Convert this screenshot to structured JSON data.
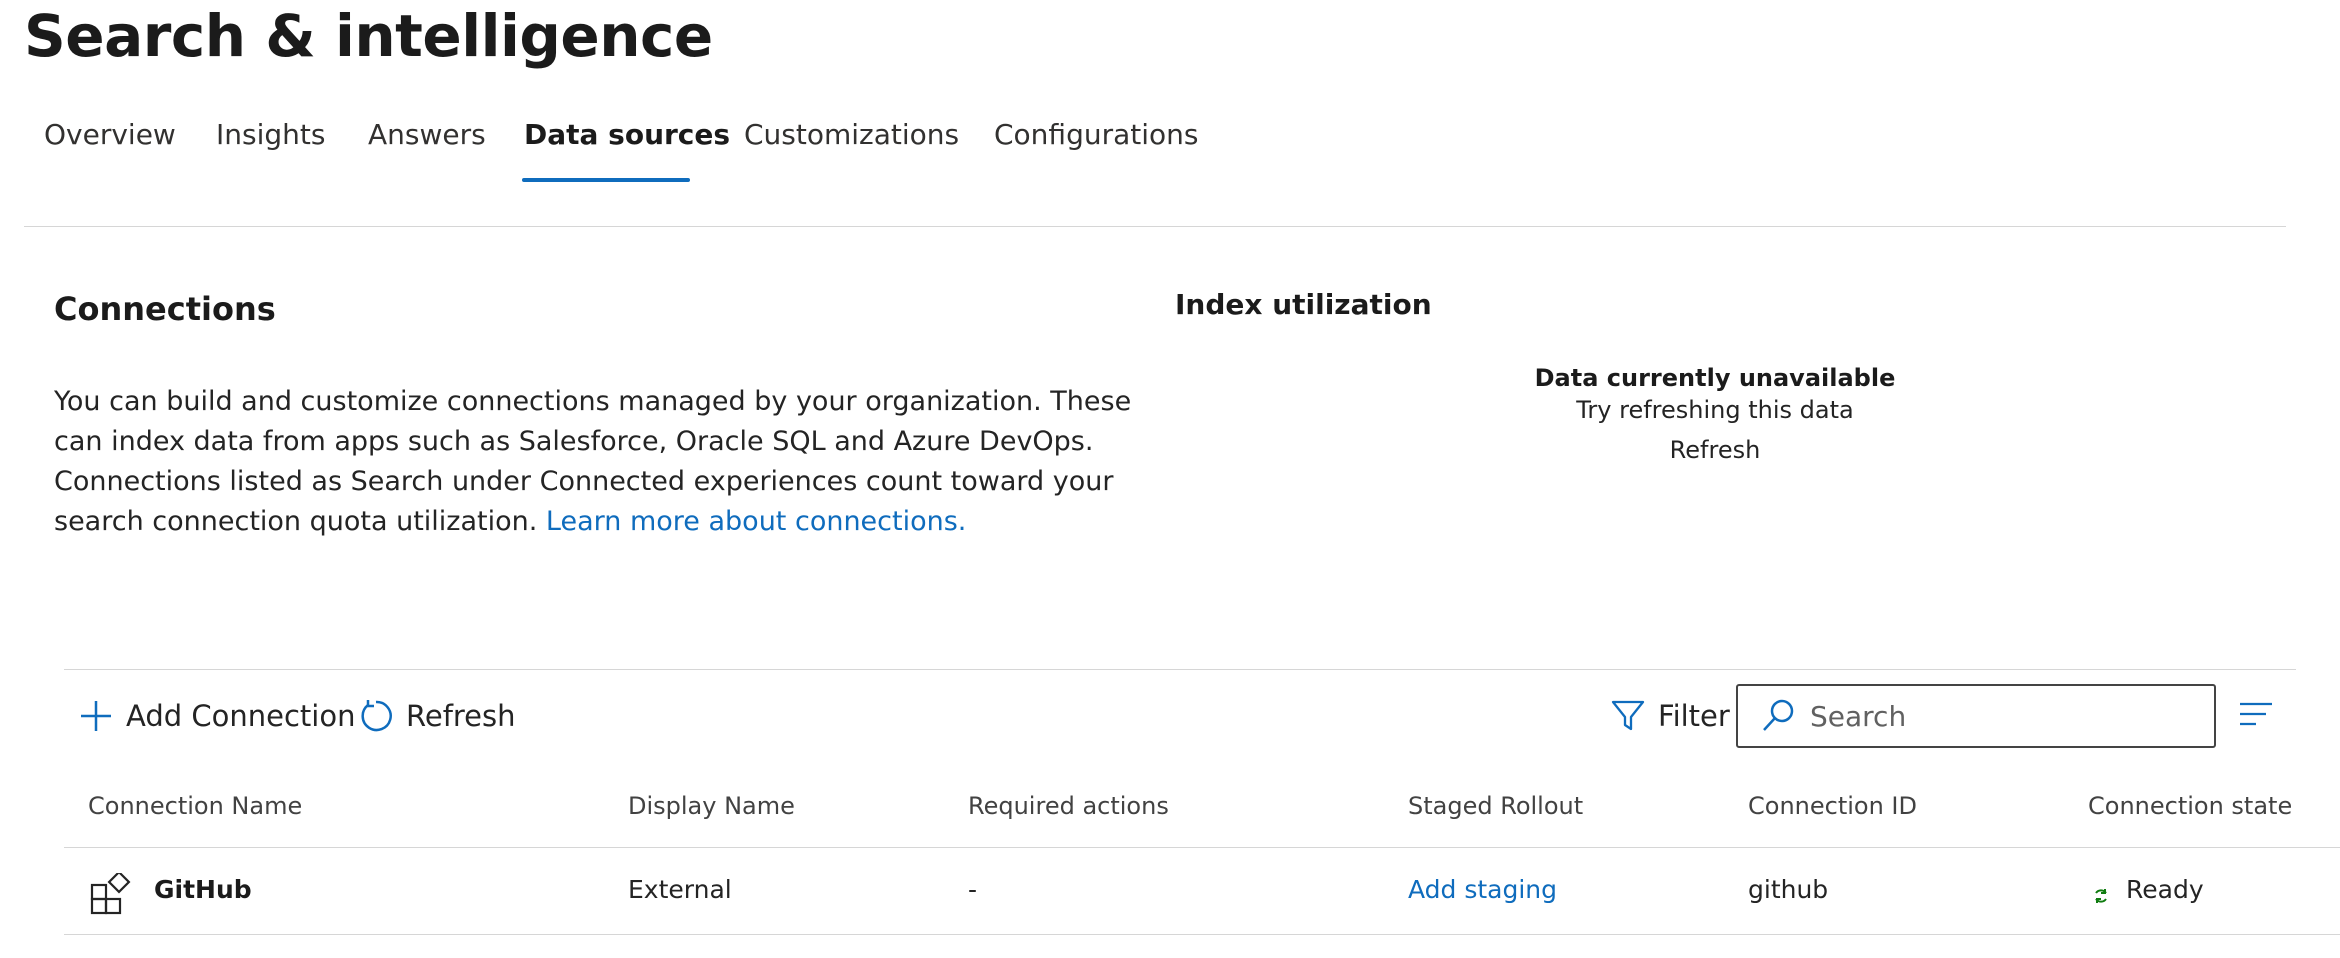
{
  "page": {
    "title": "Search & intelligence"
  },
  "tabs": [
    {
      "label": "Overview",
      "active": false
    },
    {
      "label": "Insights",
      "active": false
    },
    {
      "label": "Answers",
      "active": false
    },
    {
      "label": "Data sources",
      "active": true
    },
    {
      "label": "Customizations",
      "active": false
    },
    {
      "label": "Configurations",
      "active": false
    }
  ],
  "connections": {
    "title": "Connections",
    "description": "You can build and customize connections managed by your organization. These can index data from apps such as Salesforce, Oracle SQL and Azure DevOps. Connections listed as Search under Connected experiences count toward your search connection quota utilization.",
    "learn_more": "Learn more about connections."
  },
  "index_utilization": {
    "title": "Index utilization",
    "unavailable_title": "Data currently unavailable",
    "unavailable_sub": "Try refreshing this data",
    "refresh_label": "Refresh"
  },
  "toolbar": {
    "add_label": "Add Connection",
    "refresh_label": "Refresh",
    "filter_label": "Filter",
    "search_placeholder": "Search"
  },
  "table": {
    "columns": [
      "Connection Name",
      "Display Name",
      "Required actions",
      "Staged Rollout",
      "Connection ID",
      "Connection state"
    ],
    "rows": [
      {
        "connection_name": "GitHub",
        "display_name": "External",
        "required_actions": "-",
        "staged_rollout": "Add staging",
        "connection_id": "github",
        "connection_state": "Ready"
      }
    ]
  },
  "colors": {
    "accent": "#0f6cbd",
    "ready": "#107c10",
    "divider": "#d6d6d6"
  },
  "icons": {
    "add": "plus-icon",
    "refresh": "refresh-icon",
    "filter": "filter-icon",
    "search": "search-icon",
    "menu": "menu-lines-icon",
    "connection": "apps-add-icon",
    "state": "sync-icon"
  }
}
